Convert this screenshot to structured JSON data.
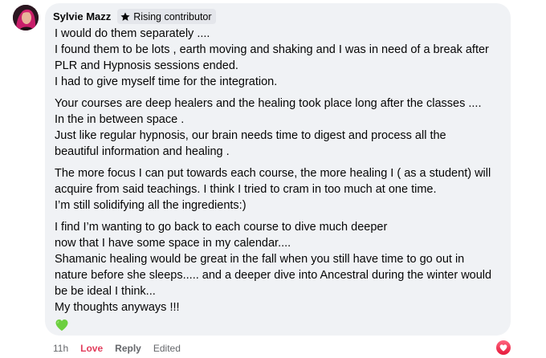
{
  "comment": {
    "author": "Sylvie Mazz",
    "badge": "Rising contributor",
    "paragraphs": [
      [
        "I would do them separately ....",
        "I found them to be lots , earth moving and shaking and I was in need of a break after",
        "PLR and Hypnosis sessions ended.",
        "I had to give myself time for the integration."
      ],
      [
        "Your courses are deep healers and the healing took place long after the classes ....",
        "In the in between space .",
        "Just like regular hypnosis, our brain needs time to digest and process all the",
        "beautiful information and healing ."
      ],
      [
        "The more focus I can put towards each course, the more healing I ( as a student) will",
        "acquire from said teachings. I think I tried to cram in too much at one time.",
        "I’m still solidifying all the ingredients:)"
      ],
      [
        "I find I’m wanting to go back to each course to dive much deeper",
        "now that I have some space in my calendar....",
        "Shamanic healing would be great in the fall when you still have time to go out in",
        "nature before she sleeps..... and a deeper dive into Ancestral during the winter would",
        "be be ideal I think...",
        "My thoughts anyways !!!"
      ]
    ],
    "emoji": "green-heart",
    "actions": {
      "time": "11h",
      "love": "Love",
      "reply": "Reply",
      "edited": "Edited"
    },
    "reaction": "love-reaction",
    "colors": {
      "bubble": "#f0f2f5",
      "love": "#e23d5c",
      "meta": "#65676b",
      "heart_green": "#6ccf3f"
    }
  }
}
